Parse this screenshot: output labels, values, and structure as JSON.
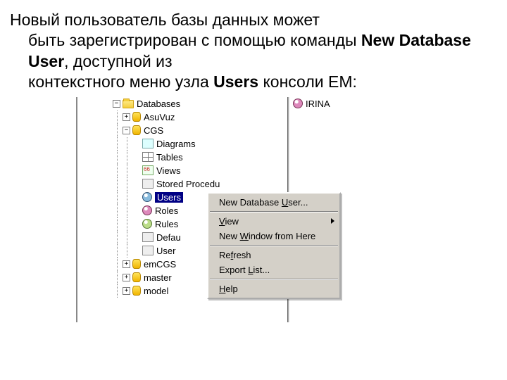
{
  "text": {
    "line1": "Новый пользователь базы данных может",
    "line2a": "быть зарегистрирован c помощью команды ",
    "line2b_bold": "New Database User",
    "line2c": ", доступной из",
    "line3a": "контекстного меню узла ",
    "line3b_bold": "Users",
    "line3c": " консоли EM:"
  },
  "tree": {
    "root": "Databases",
    "dbs": [
      "AsuVuz",
      "CGS",
      "emCGS",
      "master",
      "model"
    ],
    "cgs_children": [
      "Diagrams",
      "Tables",
      "Views",
      "Stored Procedu",
      "Users",
      "Roles",
      "Rules",
      "Defau",
      "User"
    ],
    "selected": "Users"
  },
  "right": {
    "item": "IRINA"
  },
  "context_menu": {
    "items": [
      {
        "pre": "New Database ",
        "u": "U",
        "post": "ser..."
      },
      {
        "pre": "",
        "u": "V",
        "post": "iew",
        "submenu": true
      },
      {
        "pre": "New ",
        "u": "W",
        "post": "indow from Here"
      },
      {
        "pre": "Re",
        "u": "f",
        "post": "resh"
      },
      {
        "pre": "Export ",
        "u": "L",
        "post": "ist..."
      },
      {
        "pre": "",
        "u": "H",
        "post": "elp"
      }
    ]
  }
}
